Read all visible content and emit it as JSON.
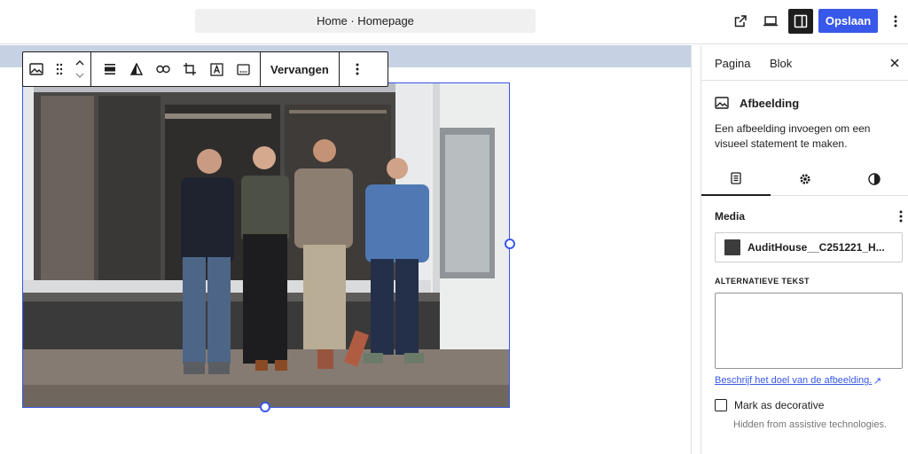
{
  "header": {
    "document_title": "Home · Homepage",
    "view_icon": "external-link-icon",
    "device_icon": "laptop-icon",
    "settings_icon": "sidebar-panel-icon",
    "save_label": "Opslaan",
    "more_icon": "more-vertical-icon",
    "accent_color": "#3858e9"
  },
  "block_toolbar": {
    "replace_label": "Vervangen",
    "icons": [
      "image-icon",
      "drag-handle-icon",
      "move-up-icon",
      "move-down-icon",
      "align-icon",
      "duotone-icon",
      "link-icon",
      "crop-icon",
      "text-overlay-icon",
      "caption-icon",
      "more-vertical-icon"
    ]
  },
  "sidebar": {
    "tabs": [
      {
        "label": "Pagina",
        "active": false
      },
      {
        "label": "Blok",
        "active": true
      }
    ],
    "close_icon": "close-icon",
    "block_card": {
      "icon": "image-icon",
      "title": "Afbeelding",
      "description": "Een afbeelding invoegen om een visueel statement te maken."
    },
    "subtabs": [
      {
        "icon": "settings-list-icon",
        "active": true
      },
      {
        "icon": "gear-icon",
        "active": false
      },
      {
        "icon": "styles-icon",
        "active": false
      }
    ],
    "media": {
      "title": "Media",
      "file_name": "AuditHouse__C251221_H..."
    },
    "alt_text": {
      "label": "ALTERNATIEVE TEKST",
      "value": "",
      "help_link": "Beschrijf het doel van de afbeelding.",
      "help_link_icon": "↗"
    },
    "decorative": {
      "label": "Mark as decorative",
      "checked": false,
      "help": "Hidden from assistive technologies."
    }
  }
}
